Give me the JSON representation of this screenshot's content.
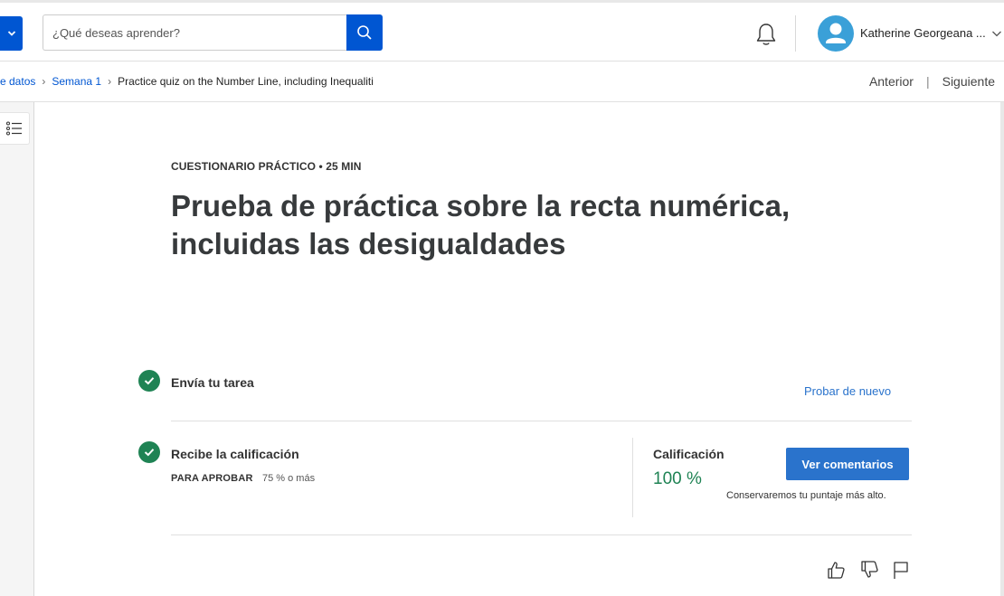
{
  "header": {
    "search_placeholder": "¿Qué deseas aprender?",
    "user_name": "Katherine Georgeana ...",
    "accent": "#0056d2"
  },
  "breadcrumb": {
    "items": [
      "e datos",
      "Semana 1"
    ],
    "current": "Practice quiz on the Number Line, including Inequaliti",
    "prev": "Anterior",
    "next": "Siguiente"
  },
  "quiz": {
    "eyebrow": "CUESTIONARIO PRÁCTICO • 25 MIN",
    "title": "Prueba de práctica sobre la recta numérica, incluidas las desigualdades"
  },
  "steps": {
    "submit_title": "Envía tu tarea",
    "retry_label": "Probar de nuevo",
    "grade_step_title": "Recibe la calificación",
    "pass_label": "PARA APROBAR",
    "pass_value": "75 % o más"
  },
  "grade": {
    "label": "Calificación",
    "value": "100 %",
    "view_feedback_label": "Ver comentarios",
    "note": "Conservaremos tu puntaje más alto.",
    "success_color": "#1f8354"
  },
  "icons": {
    "explore": "chevron-down-icon",
    "search": "search-icon",
    "notifications": "bell-icon",
    "outline": "list-icon",
    "like": "thumbs-up-icon",
    "dislike": "thumbs-down-icon",
    "report": "flag-icon"
  }
}
